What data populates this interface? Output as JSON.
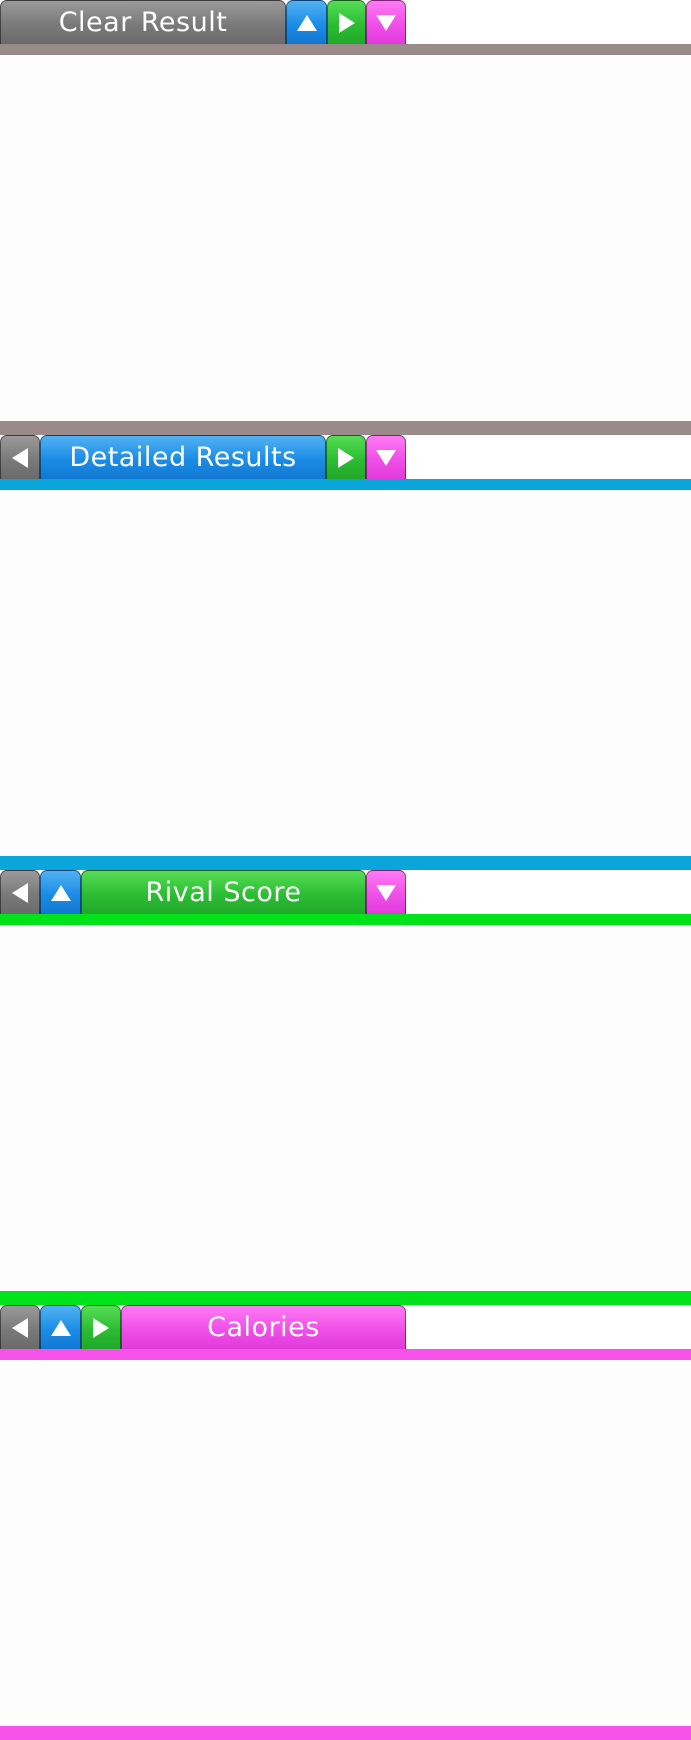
{
  "panels": [
    {
      "title": "Clear Result",
      "bar_color": "#9a8a8a",
      "active_color": "gray",
      "nav": [
        "up-arrow-icon",
        "right-arrow-icon",
        "down-arrow-icon"
      ]
    },
    {
      "title": "Detailed Results",
      "bar_color": "#0aa5db",
      "active_color": "blue",
      "nav": [
        "left-arrow-icon",
        "right-arrow-icon",
        "down-arrow-icon"
      ]
    },
    {
      "title": "Rival Score",
      "bar_color": "#00e31a",
      "active_color": "green",
      "nav": [
        "left-arrow-icon",
        "up-arrow-icon",
        "down-arrow-icon"
      ]
    },
    {
      "title": "Calories",
      "bar_color": "#f752ea",
      "active_color": "pink",
      "nav": [
        "left-arrow-icon",
        "up-arrow-icon",
        "right-arrow-icon"
      ]
    }
  ]
}
